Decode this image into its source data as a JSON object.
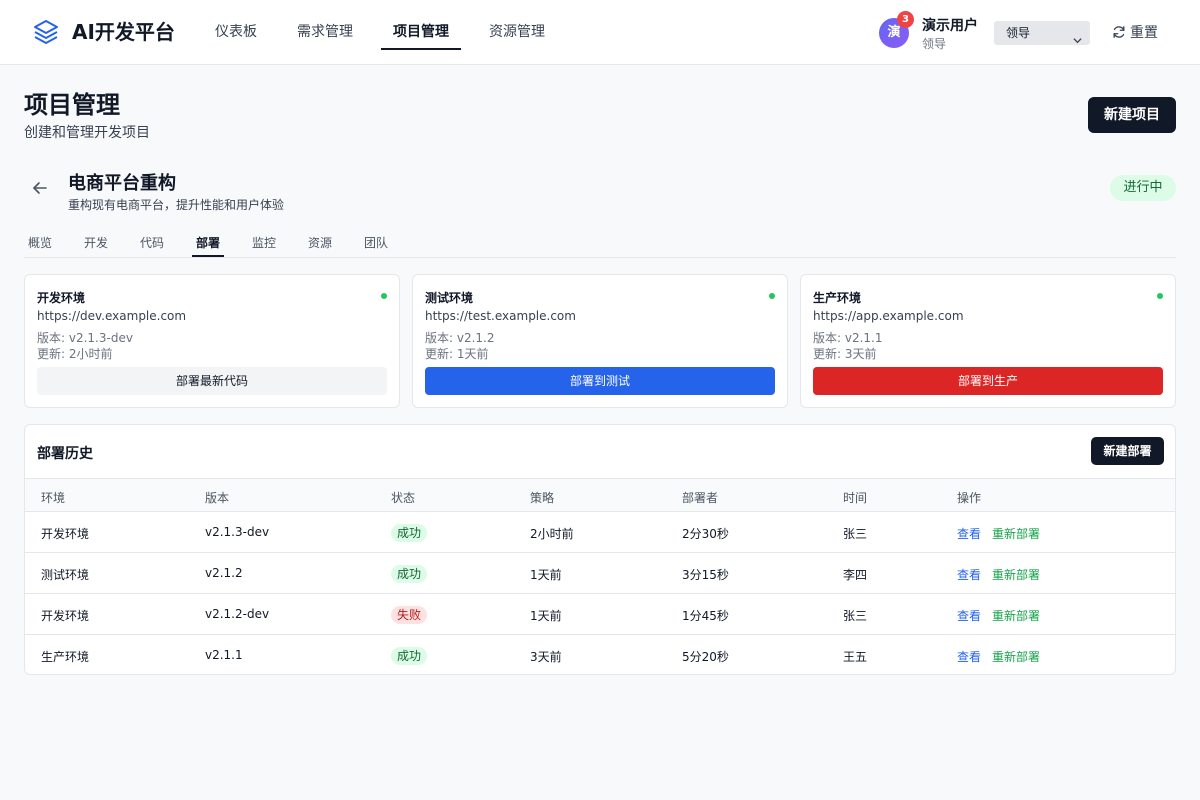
{
  "app": {
    "logo_text": "AI开发平台"
  },
  "nav": {
    "items": [
      {
        "label": "仪表板"
      },
      {
        "label": "需求管理"
      },
      {
        "label": "项目管理"
      },
      {
        "label": "资源管理"
      }
    ],
    "active": "项目管理"
  },
  "user": {
    "avatar_text": "演",
    "notification_count": "3",
    "name": "演示用户",
    "role": "领导",
    "role_select": "领导",
    "reset_label": "重置"
  },
  "page": {
    "title": "项目管理",
    "subtitle": "创建和管理开发项目",
    "new_project_label": "新建项目"
  },
  "project": {
    "title": "电商平台重构",
    "description": "重构现有电商平台，提升性能和用户体验",
    "status": "进行中"
  },
  "tabs": [
    {
      "label": "概览"
    },
    {
      "label": "开发"
    },
    {
      "label": "代码"
    },
    {
      "label": "部署"
    },
    {
      "label": "监控"
    },
    {
      "label": "资源"
    },
    {
      "label": "团队"
    }
  ],
  "active_tab": "部署",
  "environments": [
    {
      "name": "开发环境",
      "url": "https://dev.example.com",
      "version": "版本: v2.1.3-dev",
      "updated": "更新: 2小时前",
      "action": "部署最新代码",
      "status_color": "#22c55e"
    },
    {
      "name": "测试环境",
      "url": "https://test.example.com",
      "version": "版本: v2.1.2",
      "updated": "更新: 1天前",
      "action": "部署到测试",
      "status_color": "#22c55e"
    },
    {
      "name": "生产环境",
      "url": "https://app.example.com",
      "version": "版本: v2.1.1",
      "updated": "更新: 3天前",
      "action": "部署到生产",
      "status_color": "#22c55e"
    }
  ],
  "history": {
    "title": "部署历史",
    "new_deploy_label": "新建部署",
    "columns": [
      "环境",
      "版本",
      "状态",
      "策略",
      "部署者",
      "时间",
      "操作"
    ],
    "rows": [
      {
        "env": "开发环境",
        "version": "v2.1.3-dev",
        "status": "成功",
        "strategy": "2小时前",
        "deployer": "2分30秒",
        "time": "张三",
        "view": "查看",
        "redeploy": "重新部署"
      },
      {
        "env": "测试环境",
        "version": "v2.1.2",
        "status": "成功",
        "strategy": "1天前",
        "deployer": "3分15秒",
        "time": "李四",
        "view": "查看",
        "redeploy": "重新部署"
      },
      {
        "env": "开发环境",
        "version": "v2.1.2-dev",
        "status": "失败",
        "strategy": "1天前",
        "deployer": "1分45秒",
        "time": "张三",
        "view": "查看",
        "redeploy": "重新部署"
      },
      {
        "env": "生产环境",
        "version": "v2.1.1",
        "status": "成功",
        "strategy": "3天前",
        "deployer": "5分20秒",
        "time": "王五",
        "view": "查看",
        "redeploy": "重新部署"
      }
    ]
  },
  "colors": {
    "primary_dark": "#111827",
    "deploy_test": "#2563eb",
    "deploy_prod": "#dc2626",
    "success": "#22c55e",
    "link": "#2563eb",
    "redeploy_link": "#16a34a"
  },
  "icons": {
    "logo": "layers-icon",
    "back": "arrow-left-icon",
    "reset": "refresh-icon",
    "select": "chevron-down-icon"
  }
}
